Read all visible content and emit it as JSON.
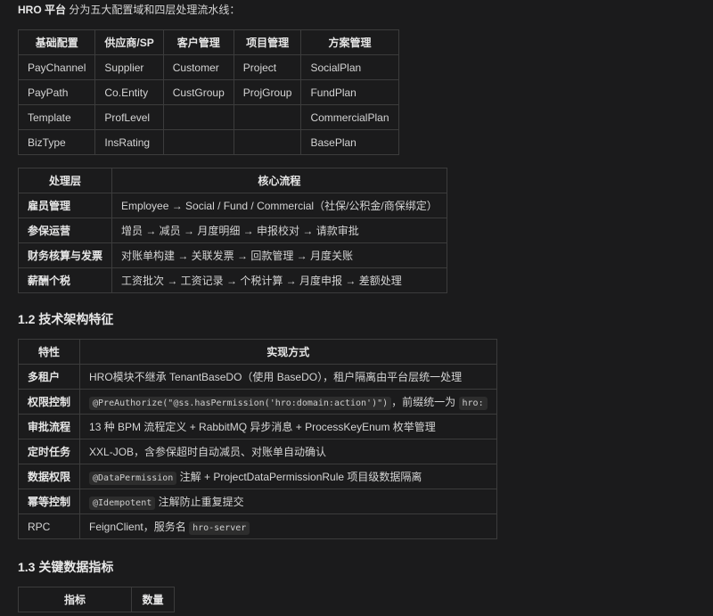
{
  "intro": {
    "brand": "HRO 平台",
    "text": " 分为五大配置域和四层处理流水线："
  },
  "config_table": {
    "headers": [
      "基础配置",
      "供应商/SP",
      "客户管理",
      "项目管理",
      "方案管理"
    ],
    "rows": [
      [
        "PayChannel",
        "Supplier",
        "Customer",
        "Project",
        "SocialPlan"
      ],
      [
        "PayPath",
        "Co.Entity",
        "CustGroup",
        "ProjGroup",
        "FundPlan"
      ],
      [
        "Template",
        "ProfLevel",
        "",
        "",
        "CommercialPlan"
      ],
      [
        "BizType",
        "InsRating",
        "",
        "",
        "BasePlan"
      ]
    ]
  },
  "pipeline_table": {
    "headers": [
      "处理层",
      "核心流程"
    ],
    "rows": [
      [
        "雇员管理",
        "Employee → Social / Fund / Commercial（社保/公积金/商保绑定）"
      ],
      [
        "参保运营",
        "增员 → 减员 → 月度明细 → 申报校对 → 请款审批"
      ],
      [
        "财务核算与发票",
        "对账单构建 → 关联发票 → 回款管理 → 月度关账"
      ],
      [
        "薪酬个税",
        "工资批次 → 工资记录 → 个税计算 → 月度申报 → 差额处理"
      ]
    ]
  },
  "section_1_2": {
    "title": "1.2 技术架构特征"
  },
  "arch_table": {
    "headers": [
      "特性",
      "实现方式"
    ],
    "rows": [
      {
        "feature": "多租户",
        "text": "HRO模块不继承 TenantBaseDO（使用 BaseDO），租户隔离由平台层统一处理"
      },
      {
        "feature": "权限控制",
        "code": "@PreAuthorize(\"@ss.hasPermission('hro:domain:action')\")",
        "text": "，前缀统一为",
        "code2": "hro:"
      },
      {
        "feature": "审批流程",
        "text": "13 种 BPM 流程定义 + RabbitMQ 异步消息 + ProcessKeyEnum 枚举管理"
      },
      {
        "feature": "定时任务",
        "text": "XXL-JOB，含参保超时自动减员、对账单自动确认"
      },
      {
        "feature": "数据权限",
        "code": "@DataPermission",
        "text": " 注解 + ProjectDataPermissionRule 项目级数据隔离"
      },
      {
        "feature": "幂等控制",
        "code": "@Idempotent",
        "text": " 注解防止重复提交"
      },
      {
        "feature": "RPC",
        "text": "FeignClient，服务名",
        "code2": "hro-server"
      }
    ]
  },
  "section_1_3": {
    "title": "1.3 关键数据指标"
  },
  "metrics_table": {
    "headers": [
      "指标",
      "数量"
    ]
  }
}
